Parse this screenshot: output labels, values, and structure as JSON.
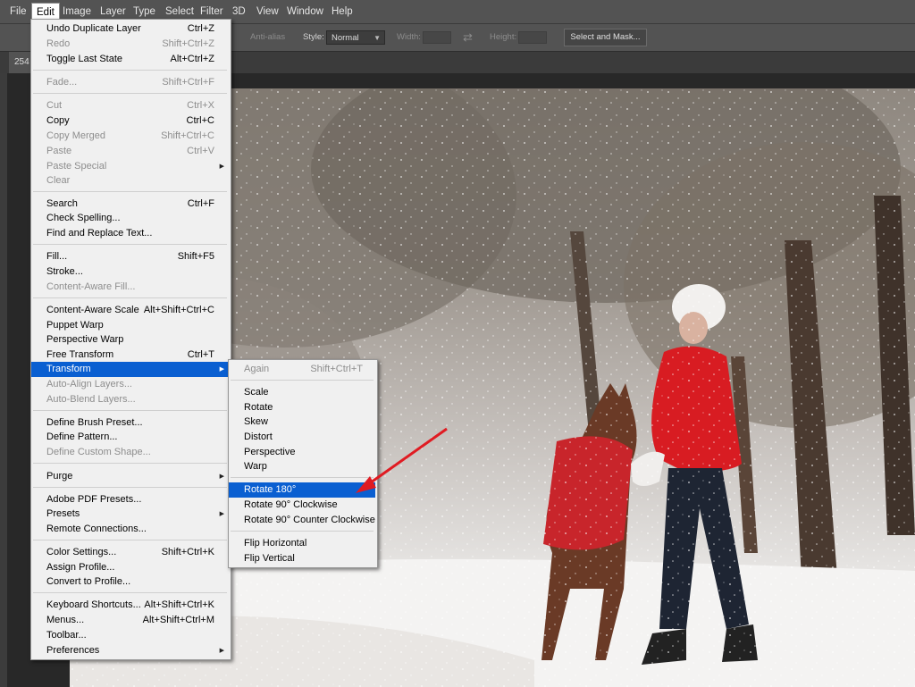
{
  "menubar": {
    "items": [
      "File",
      "Edit",
      "Image",
      "Layer",
      "Type",
      "Select",
      "Filter",
      "3D",
      "View",
      "Window",
      "Help"
    ],
    "active": "Edit"
  },
  "options_bar": {
    "antialias_label": "Anti-alias",
    "style_label": "Style:",
    "style_value": "Normal",
    "width_label": "Width:",
    "height_label": "Height:",
    "select_mask_label": "Select and Mask..."
  },
  "document_tab": {
    "label": "254"
  },
  "edit_menu": {
    "items": [
      {
        "label": "Undo Duplicate Layer",
        "shortcut": "Ctrl+Z"
      },
      {
        "label": "Redo",
        "shortcut": "Shift+Ctrl+Z",
        "disabled": true
      },
      {
        "label": "Toggle Last State",
        "shortcut": "Alt+Ctrl+Z"
      },
      {
        "label": "Fade...",
        "shortcut": "Shift+Ctrl+F",
        "disabled": true
      },
      {
        "label": "Cut",
        "shortcut": "Ctrl+X",
        "disabled": true
      },
      {
        "label": "Copy",
        "shortcut": "Ctrl+C"
      },
      {
        "label": "Copy Merged",
        "shortcut": "Shift+Ctrl+C",
        "disabled": true
      },
      {
        "label": "Paste",
        "shortcut": "Ctrl+V",
        "disabled": true
      },
      {
        "label": "Paste Special",
        "shortcut": "",
        "disabled": true,
        "submenu": true
      },
      {
        "label": "Clear",
        "shortcut": "",
        "disabled": true
      },
      {
        "label": "Search",
        "shortcut": "Ctrl+F"
      },
      {
        "label": "Check Spelling...",
        "shortcut": ""
      },
      {
        "label": "Find and Replace Text...",
        "shortcut": ""
      },
      {
        "label": "Fill...",
        "shortcut": "Shift+F5"
      },
      {
        "label": "Stroke...",
        "shortcut": ""
      },
      {
        "label": "Content-Aware Fill...",
        "shortcut": "",
        "disabled": true
      },
      {
        "label": "Content-Aware Scale",
        "shortcut": "Alt+Shift+Ctrl+C"
      },
      {
        "label": "Puppet Warp",
        "shortcut": ""
      },
      {
        "label": "Perspective Warp",
        "shortcut": ""
      },
      {
        "label": "Free Transform",
        "shortcut": "Ctrl+T"
      },
      {
        "label": "Transform",
        "shortcut": "",
        "submenu": true,
        "highlighted": true
      },
      {
        "label": "Auto-Align Layers...",
        "shortcut": "",
        "disabled": true
      },
      {
        "label": "Auto-Blend Layers...",
        "shortcut": "",
        "disabled": true
      },
      {
        "label": "Define Brush Preset...",
        "shortcut": ""
      },
      {
        "label": "Define Pattern...",
        "shortcut": ""
      },
      {
        "label": "Define Custom Shape...",
        "shortcut": "",
        "disabled": true
      },
      {
        "label": "Purge",
        "shortcut": "",
        "submenu": true
      },
      {
        "label": "Adobe PDF Presets...",
        "shortcut": ""
      },
      {
        "label": "Presets",
        "shortcut": "",
        "submenu": true
      },
      {
        "label": "Remote Connections...",
        "shortcut": ""
      },
      {
        "label": "Color Settings...",
        "shortcut": "Shift+Ctrl+K"
      },
      {
        "label": "Assign Profile...",
        "shortcut": ""
      },
      {
        "label": "Convert to Profile...",
        "shortcut": ""
      },
      {
        "label": "Keyboard Shortcuts...",
        "shortcut": "Alt+Shift+Ctrl+K"
      },
      {
        "label": "Menus...",
        "shortcut": "Alt+Shift+Ctrl+M"
      },
      {
        "label": "Toolbar...",
        "shortcut": ""
      },
      {
        "label": "Preferences",
        "shortcut": "",
        "submenu": true
      }
    ]
  },
  "transform_menu": {
    "items": [
      {
        "label": "Again",
        "shortcut": "Shift+Ctrl+T",
        "disabled": true
      },
      {
        "label": "Scale",
        "shortcut": ""
      },
      {
        "label": "Rotate",
        "shortcut": ""
      },
      {
        "label": "Skew",
        "shortcut": ""
      },
      {
        "label": "Distort",
        "shortcut": ""
      },
      {
        "label": "Perspective",
        "shortcut": ""
      },
      {
        "label": "Warp",
        "shortcut": ""
      },
      {
        "label": "Rotate 180°",
        "shortcut": "",
        "highlighted": true
      },
      {
        "label": "Rotate 90° Clockwise",
        "shortcut": ""
      },
      {
        "label": "Rotate 90° Counter Clockwise",
        "shortcut": ""
      },
      {
        "label": "Flip Horizontal",
        "shortcut": ""
      },
      {
        "label": "Flip Vertical",
        "shortcut": ""
      }
    ]
  },
  "colors": {
    "highlight": "#0a5fd1",
    "annotation_arrow": "#e01b22",
    "jacket": "#d81c22"
  }
}
